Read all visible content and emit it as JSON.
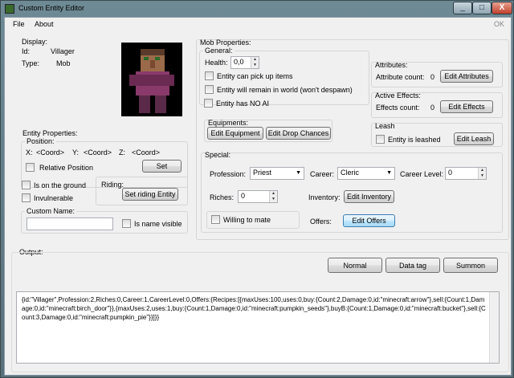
{
  "window": {
    "title": "Custom Entity Editor",
    "close_glyph": "X"
  },
  "menu": {
    "file": "File",
    "about": "About",
    "ok": "OK"
  },
  "display": {
    "title": "Display:",
    "id_label": "Id:",
    "id_value": "Villager",
    "type_label": "Type:",
    "type_value": "Mob"
  },
  "entity_properties": {
    "title": "Entity Properties:",
    "position": {
      "title": "Position:",
      "x_label": "X:",
      "x_value": "<Coord>",
      "y_label": "Y:",
      "y_value": "<Coord>",
      "z_label": "Z:",
      "z_value": "<Coord>"
    },
    "relative_position": "Relative Position",
    "set_button": "Set",
    "on_ground": "Is on the ground",
    "invulnerable": "Invulnerable",
    "riding_label": "Riding:",
    "set_riding_button": "Set riding Entity",
    "custom_name_title": "Custom Name:",
    "custom_name_value": "",
    "name_visible": "Is name visible"
  },
  "mob_properties": {
    "title": "Mob Properties:",
    "general": {
      "title": "General:",
      "health_label": "Health:",
      "health_value": "0,0",
      "can_pick_up": "Entity can pick up items",
      "remain_in_world": "Entity will remain in world (won't despawn)",
      "no_ai": "Entity has NO AI"
    },
    "equipments": {
      "title": "Equipments:",
      "edit_equipment": "Edit Equipment",
      "edit_drop_chances": "Edit Drop Chances"
    },
    "attributes": {
      "title": "Attributes:",
      "count_label": "Attribute count:",
      "count_value": "0",
      "edit_button": "Edit Attributes"
    },
    "active_effects": {
      "title": "Active Effects:",
      "count_label": "Effects count:",
      "count_value": "0",
      "edit_button": "Edit Effects"
    },
    "leash": {
      "title": "Leash",
      "is_leashed": "Entity is leashed",
      "edit_button": "Edit Leash"
    }
  },
  "special": {
    "title": "Special:",
    "profession_label": "Profession:",
    "profession_value": "Priest",
    "career_label": "Career:",
    "career_value": "Cleric",
    "career_level_label": "Career Level:",
    "career_level_value": "0",
    "riches_label": "Riches:",
    "riches_value": "0",
    "inventory_label": "Inventory:",
    "edit_inventory": "Edit Inventory",
    "willing_to_mate": "Willing to mate",
    "offers_label": "Offers:",
    "edit_offers": "Edit Offers"
  },
  "output": {
    "title": "Output:",
    "normal_button": "Normal",
    "datatag_button": "Data tag",
    "summon_button": "Summon",
    "text": "{id:\"Villager\",Profession:2,Riches:0,Career:1,CareerLevel:0,Offers:{Recipes:[{maxUses:100,uses:0,buy:{Count:2,Damage:0,id:\"minecraft:arrow\"},sell:{Count:1,Damage:0,id:\"minecraft:birch_door\"}},{maxUses:2,uses:1,buy:{Count:1,Damage:0,id:\"minecraft:pumpkin_seeds\"},buyB:{Count:1,Damage:0,id:\"minecraft:bucket\"},sell:{Count:3,Damage:0,id:\"minecraft:pumpkin_pie\"}}]}}"
  },
  "icons": {
    "app": "minecraft-block-icon",
    "portrait": "villager-portrait-image",
    "spinner": "spinner-arrows-icon",
    "combo": "chevron-down-icon"
  }
}
